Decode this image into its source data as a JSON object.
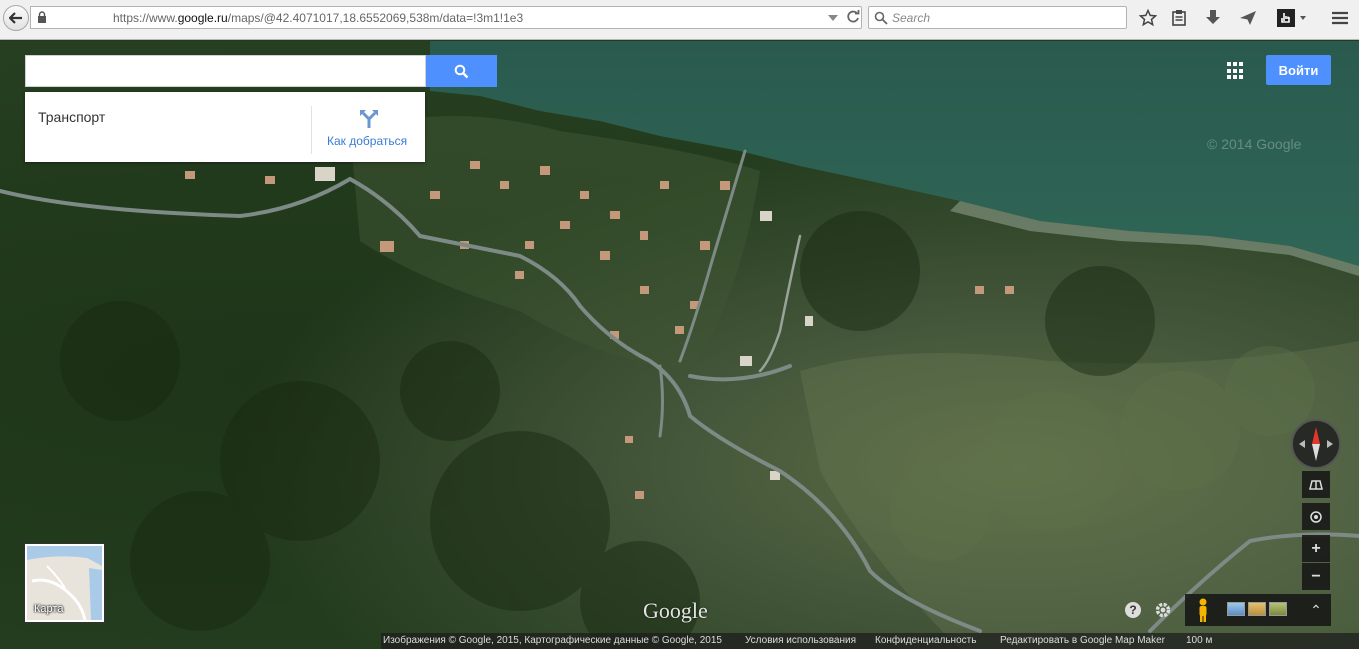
{
  "browser": {
    "url_prefix": "https://www.",
    "url_domain": "google.ru",
    "url_path": "/maps/@42.4071017,18.6552069,538m/data=!3m1!1e3",
    "search_placeholder": "Search"
  },
  "maps": {
    "search_value": "",
    "panel_title": "Транспорт",
    "directions_label": "Как добраться",
    "signin_label": "Войти",
    "watermark": "© 2014 Google",
    "minimap_label": "Карта",
    "logo": "Google",
    "zoom_in": "+",
    "zoom_out": "−",
    "expand": "⌃"
  },
  "footer": {
    "imagery": "Изображения © Google, 2015, Картографические данные © Google, 2015",
    "terms": "Условия использования",
    "privacy": "Конфиденциальность",
    "edit": "Редактировать в Google Map Maker",
    "scale": "100 м"
  },
  "colors": {
    "accent_blue": "#4d90fe",
    "link_blue": "#3a7bd5"
  },
  "icons": [
    "back-arrow-icon",
    "lock-icon",
    "reload-icon",
    "search-icon",
    "star-icon",
    "clipboard-icon",
    "download-icon",
    "send-icon",
    "extension-icon",
    "menu-icon",
    "apps-grid-icon",
    "directions-icon",
    "compass-icon",
    "tilt-icon",
    "my-location-icon",
    "help-icon",
    "gear-icon",
    "pegman-icon"
  ]
}
